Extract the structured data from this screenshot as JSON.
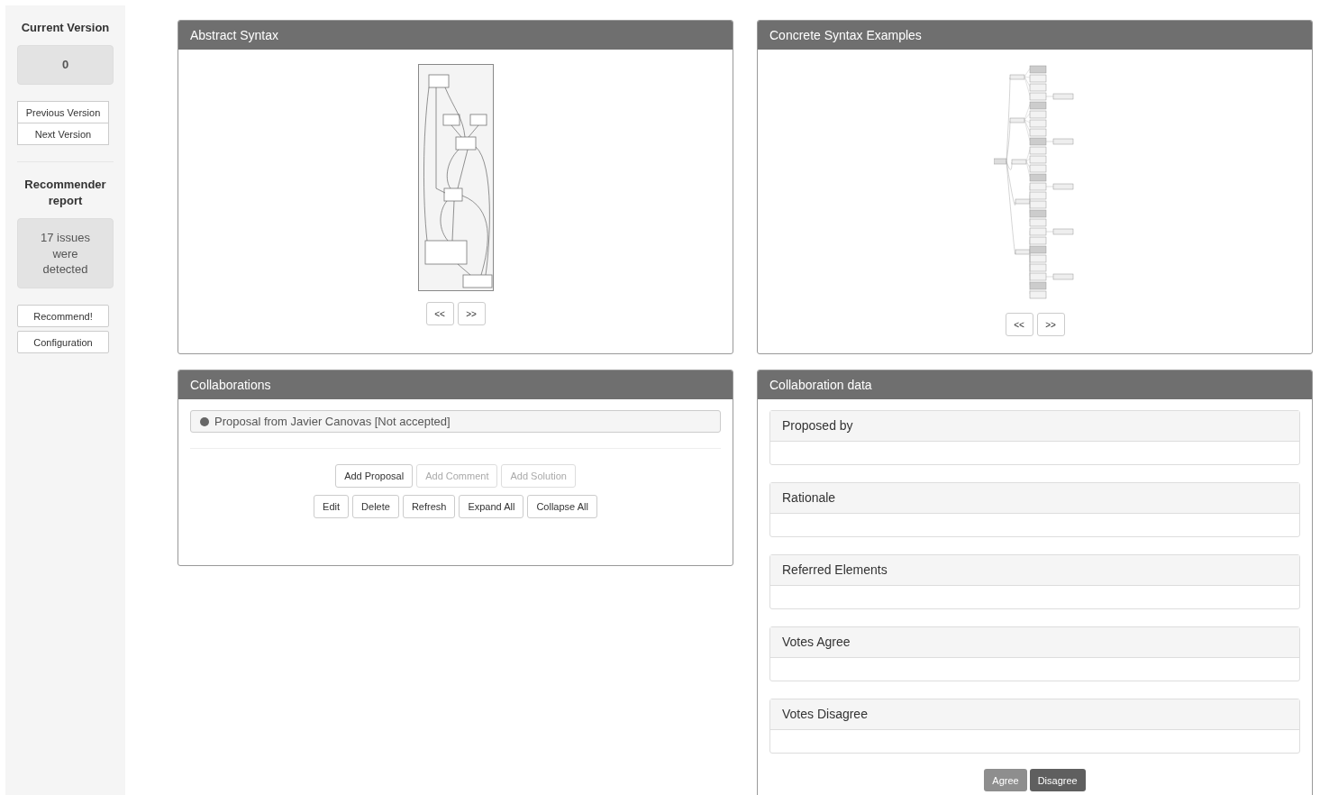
{
  "sidebar": {
    "current_version": {
      "title": "Current Version",
      "value": "0",
      "buttons": [
        {
          "label": "Previous Version"
        },
        {
          "label": "Next Version"
        }
      ]
    },
    "recommender": {
      "title": "Recommender report",
      "summary": "17 issues were detected",
      "buttons": [
        {
          "label": "Recommend!"
        },
        {
          "label": "Configuration"
        }
      ]
    }
  },
  "abstract_syntax": {
    "title": "Abstract Syntax",
    "nav": [
      "<<",
      ">>"
    ]
  },
  "concrete_syntax": {
    "title": "Concrete Syntax Examples",
    "nav": [
      "<<",
      ">>"
    ]
  },
  "collaborations": {
    "title": "Collaborations",
    "items": [
      {
        "text": "Proposal from Javier Canovas [Not accepted]"
      }
    ],
    "action_rows": [
      [
        {
          "label": "Add Proposal",
          "disabled": false
        },
        {
          "label": "Add Comment",
          "disabled": true
        },
        {
          "label": "Add Solution",
          "disabled": true
        }
      ],
      [
        {
          "label": "Edit",
          "disabled": false
        },
        {
          "label": "Delete",
          "disabled": false
        },
        {
          "label": "Refresh",
          "disabled": false
        },
        {
          "label": "Expand All",
          "disabled": false
        },
        {
          "label": "Collapse All",
          "disabled": false
        }
      ]
    ]
  },
  "collaboration_data": {
    "title": "Collaboration data",
    "fields": [
      {
        "label": "Proposed by"
      },
      {
        "label": "Rationale"
      },
      {
        "label": "Referred Elements"
      },
      {
        "label": "Votes Agree"
      },
      {
        "label": "Votes Disagree"
      }
    ],
    "buttons": [
      {
        "label": "Agree",
        "disabled": true
      },
      {
        "label": "Disagree",
        "disabled": false
      }
    ]
  }
}
